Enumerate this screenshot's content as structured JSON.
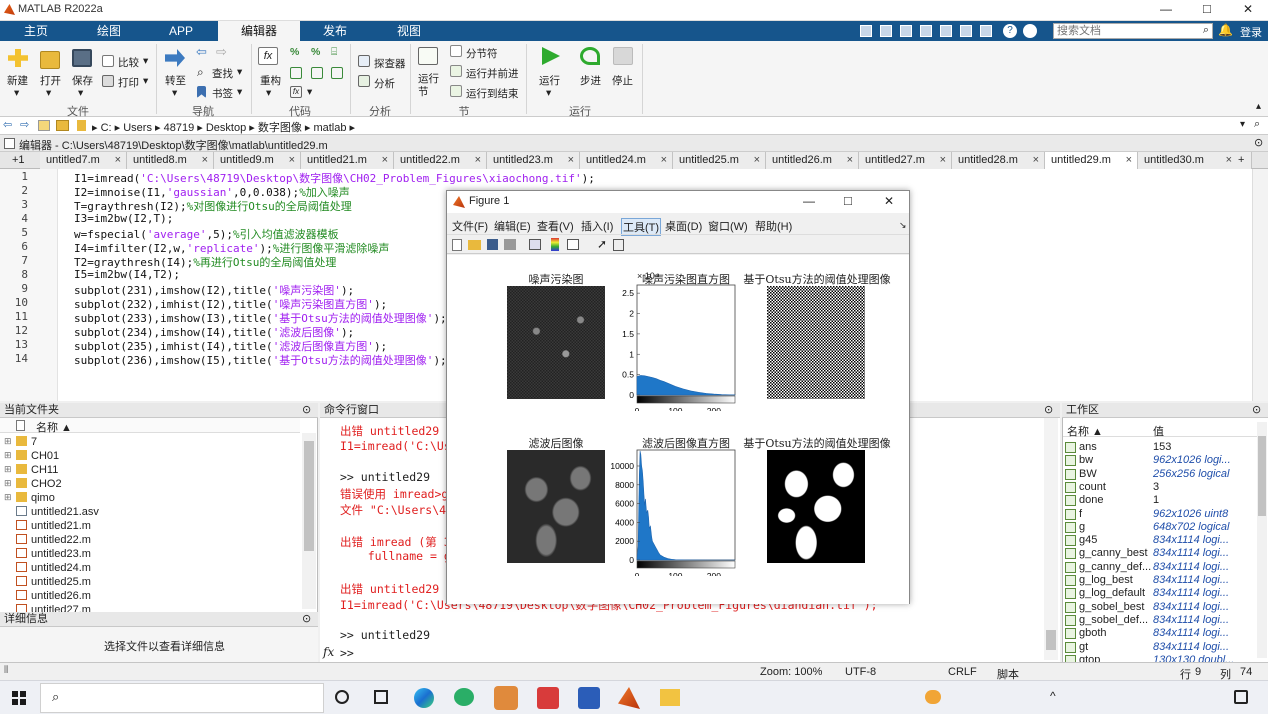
{
  "window": {
    "title": "MATLAB R2022a",
    "min": "—",
    "max": "□",
    "close": "✕"
  },
  "ribbon_tabs": [
    {
      "label": "主页"
    },
    {
      "label": "绘图"
    },
    {
      "label": "APP"
    },
    {
      "label": "编辑器"
    },
    {
      "label": "发布"
    },
    {
      "label": "视图"
    }
  ],
  "search": {
    "placeholder": "搜索文档",
    "login": "登录"
  },
  "ribbon": {
    "file": {
      "group": "文件",
      "new": "新建",
      "open": "打开",
      "save": "保存",
      "compare": "比较",
      "print": "打印"
    },
    "nav": {
      "group": "导航",
      "goto": "转至",
      "find": "查找",
      "bookmark": "书签"
    },
    "code": {
      "group": "代码",
      "refactor": "重构"
    },
    "analyze": {
      "group": "分析",
      "profiler": "探查器",
      "analyze": "分析"
    },
    "section": {
      "group": "节",
      "run_section": "运行节",
      "section_break": "分节符",
      "run_advance": "运行并前进",
      "run_to_end": "运行到结束"
    },
    "run": {
      "group": "运行",
      "run": "运行",
      "step": "步进",
      "stop": "停止"
    }
  },
  "address": [
    "C:",
    "Users",
    "48719",
    "Desktop",
    "数字图像",
    "matlab"
  ],
  "editor": {
    "header": "编辑器 - C:\\Users\\48719\\Desktop\\数字图像\\matlab\\untitled29.m",
    "plus_tab": "+1",
    "tabs": [
      "untitled7.m",
      "untitled8.m",
      "untitled9.m",
      "untitled21.m",
      "untitled22.m",
      "untitled23.m",
      "untitled24.m",
      "untitled25.m",
      "untitled26.m",
      "untitled27.m",
      "untitled28.m",
      "untitled29.m",
      "untitled30.m"
    ],
    "active_tab": 11,
    "lines": [
      {
        "n": "1",
        "a": "I1=imread(",
        "s": "'C:\\Users\\48719\\Desktop\\数字图像\\CH02_Problem_Figures\\xiaochong.tif'",
        "b": ");",
        "c": ""
      },
      {
        "n": "2",
        "a": "I2=imnoise(I1,",
        "s": "'gaussian'",
        "b": ",0,0.038);",
        "c": "%加入噪声"
      },
      {
        "n": "3",
        "a": "T=graythresh(I2);",
        "s": "",
        "b": "",
        "c": "%对图像进行Otsu的全局阈值处理"
      },
      {
        "n": "4",
        "a": "I3=im2bw(I2,T);",
        "s": "",
        "b": "",
        "c": ""
      },
      {
        "n": "5",
        "a": "w=fspecial(",
        "s": "'average'",
        "b": ",5);",
        "c": "%引入均值滤波器模板"
      },
      {
        "n": "6",
        "a": "I4=imfilter(I2,w,",
        "s": "'replicate'",
        "b": ");",
        "c": "%进行图像平滑滤除噪声"
      },
      {
        "n": "7",
        "a": "T2=graythresh(I4);",
        "s": "",
        "b": "",
        "c": "%再进行Otsu的全局阈值处理"
      },
      {
        "n": "8",
        "a": "I5=im2bw(I4,T2);",
        "s": "",
        "b": "",
        "c": ""
      },
      {
        "n": "9",
        "a": "subplot(231),imshow(I2),title(",
        "s": "'噪声污染图'",
        "b": ");",
        "c": ""
      },
      {
        "n": "10",
        "a": "subplot(232),imhist(I2),title(",
        "s": "'噪声污染图直方图'",
        "b": ");",
        "c": ""
      },
      {
        "n": "11",
        "a": "subplot(233),imshow(I3),title(",
        "s": "'基于Otsu方法的阈值处理图像'",
        "b": ");",
        "c": ""
      },
      {
        "n": "12",
        "a": "subplot(234),imshow(I4),title(",
        "s": "'滤波后图像'",
        "b": ");",
        "c": ""
      },
      {
        "n": "13",
        "a": "subplot(235),imhist(I4),title(",
        "s": "'滤波后图像直方图'",
        "b": ");",
        "c": ""
      },
      {
        "n": "14",
        "a": "subplot(236),imshow(I5),title(",
        "s": "'基于Otsu方法的阈值处理图像'",
        "b": ");",
        "c": ""
      }
    ]
  },
  "current_folder": {
    "title": "当前文件夹",
    "col": "名称 ▲",
    "items": [
      {
        "name": "7",
        "type": "folder"
      },
      {
        "name": "CH01",
        "type": "folder"
      },
      {
        "name": "CH11",
        "type": "folder"
      },
      {
        "name": "CHO2",
        "type": "folder"
      },
      {
        "name": "qimo",
        "type": "folder"
      },
      {
        "name": "untitled21.asv",
        "type": "file"
      },
      {
        "name": "untitled21.m",
        "type": "m"
      },
      {
        "name": "untitled22.m",
        "type": "m"
      },
      {
        "name": "untitled23.m",
        "type": "m"
      },
      {
        "name": "untitled24.m",
        "type": "m"
      },
      {
        "name": "untitled25.m",
        "type": "m"
      },
      {
        "name": "untitled26.m",
        "type": "m"
      },
      {
        "name": "untitled27.m",
        "type": "m"
      }
    ],
    "details_title": "详细信息",
    "details_text": "选择文件以查看详细信息"
  },
  "command_window": {
    "title": "命令行窗口",
    "prompt": ">>",
    "fx": "fx",
    "lines": [
      {
        "t": "出错 untitled29 (",
        "cls": "err"
      },
      {
        "t": "I1=imread('C:\\Us",
        "cls": "err"
      },
      {
        "t": "",
        "cls": ""
      },
      {
        "t": ">> untitled29",
        "cls": ""
      },
      {
        "t": "错误使用 imread>ge",
        "cls": "err"
      },
      {
        "t": "文件 \"C:\\Users\\48",
        "cls": "err"
      },
      {
        "t": "",
        "cls": ""
      },
      {
        "t": "出错 imread (第 3",
        "cls": "err"
      },
      {
        "t": "    fullname = g",
        "cls": "err"
      },
      {
        "t": "",
        "cls": ""
      },
      {
        "t": "出错 untitled29 (",
        "cls": "err"
      },
      {
        "t": "I1=imread('C:\\Users\\48719\\Desktop\\数字图像\\CH02_Problem_Figures\\diandian.tif');",
        "cls": "err"
      },
      {
        "t": "",
        "cls": ""
      },
      {
        "t": ">> untitled29",
        "cls": ""
      }
    ]
  },
  "workspace": {
    "title": "工作区",
    "col_name": "名称 ▲",
    "col_value": "值",
    "vars": [
      {
        "name": "ans",
        "value": "153",
        "italic": false
      },
      {
        "name": "bw",
        "value": "962x1026 logi...",
        "italic": true
      },
      {
        "name": "BW",
        "value": "256x256 logical",
        "italic": true
      },
      {
        "name": "count",
        "value": "3",
        "italic": false
      },
      {
        "name": "done",
        "value": "1",
        "italic": false
      },
      {
        "name": "f",
        "value": "962x1026 uint8",
        "italic": true
      },
      {
        "name": "g",
        "value": "648x702 logical",
        "italic": true
      },
      {
        "name": "g45",
        "value": "834x1114 logi...",
        "italic": true
      },
      {
        "name": "g_canny_best",
        "value": "834x1114 logi...",
        "italic": true
      },
      {
        "name": "g_canny_def...",
        "value": "834x1114 logi...",
        "italic": true
      },
      {
        "name": "g_log_best",
        "value": "834x1114 logi...",
        "italic": true
      },
      {
        "name": "g_log_default",
        "value": "834x1114 logi...",
        "italic": true
      },
      {
        "name": "g_sobel_best",
        "value": "834x1114 logi...",
        "italic": true
      },
      {
        "name": "g_sobel_def...",
        "value": "834x1114 logi...",
        "italic": true
      },
      {
        "name": "gboth",
        "value": "834x1114 logi...",
        "italic": true
      },
      {
        "name": "gt",
        "value": "834x1114 logi...",
        "italic": true
      },
      {
        "name": "gtop",
        "value": "130x130 doubl...",
        "italic": true
      }
    ]
  },
  "status": {
    "zoom": "Zoom: 100%",
    "encoding": "UTF-8",
    "eol": "CRLF",
    "type": "脚本",
    "row": "行",
    "row_val": "9",
    "col": "列",
    "col_val": "74"
  },
  "figure": {
    "title": "Figure 1",
    "menus": [
      "文件(F)",
      "编辑(E)",
      "查看(V)",
      "插入(I)",
      "工具(T)",
      "桌面(D)",
      "窗口(W)",
      "帮助(H)"
    ],
    "subplot_titles": [
      "噪声污染图",
      "噪声污染图直方图",
      "基于Otsu方法的阈值处理图像",
      "滤波后图像",
      "滤波后图像直方图",
      "基于Otsu方法的阈值处理图像"
    ],
    "exp_label": "× 10⁴"
  },
  "chart_data": [
    {
      "type": "area",
      "title": "噪声污染图直方图",
      "x_ticks": [
        "0",
        "100",
        "200"
      ],
      "y_ticks": [
        "0",
        "0.5",
        "1",
        "1.5",
        "2",
        "2.5"
      ],
      "xlim": [
        0,
        255
      ],
      "ylim": [
        0,
        27000
      ],
      "x": [
        0,
        5,
        10,
        20,
        30,
        40,
        50,
        60,
        70,
        80,
        90,
        100,
        120,
        140,
        160,
        180,
        200,
        220,
        240,
        255
      ],
      "values": [
        4500,
        4700,
        4800,
        4700,
        4500,
        4300,
        4000,
        3600,
        3300,
        2900,
        2500,
        2100,
        1500,
        1000,
        650,
        400,
        230,
        120,
        60,
        20
      ]
    },
    {
      "type": "area",
      "title": "滤波后图像直方图",
      "x_ticks": [
        "0",
        "100",
        "200"
      ],
      "y_ticks": [
        "0",
        "2000",
        "4000",
        "6000",
        "8000",
        "10000"
      ],
      "xlim": [
        0,
        255
      ],
      "ylim": [
        0,
        11700
      ],
      "x": [
        0,
        3,
        6,
        8,
        10,
        12,
        14,
        16,
        18,
        20,
        22,
        25,
        28,
        30,
        32,
        35,
        38,
        40,
        44,
        48,
        52,
        56,
        60,
        70,
        80,
        90,
        100,
        120,
        150,
        200,
        255
      ],
      "values": [
        0,
        1500,
        9000,
        11600,
        11200,
        10000,
        9500,
        8400,
        7000,
        5800,
        6500,
        5000,
        5300,
        4600,
        3400,
        3600,
        2500,
        2000,
        1700,
        1400,
        1100,
        800,
        550,
        300,
        150,
        80,
        40,
        15,
        5,
        0,
        0
      ]
    }
  ]
}
